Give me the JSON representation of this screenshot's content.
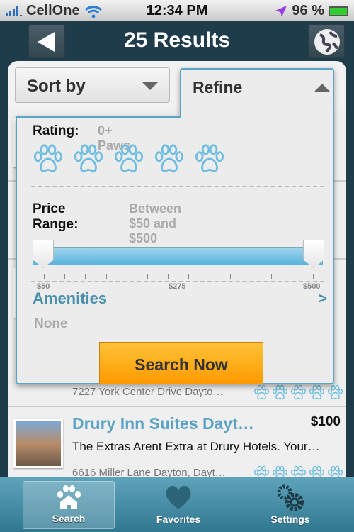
{
  "status_bar": {
    "carrier": "CellOne",
    "time": "12:34 PM",
    "battery": "96 %",
    "icons": [
      "signal-icon",
      "wifi-icon",
      "location-icon",
      "battery-charging-icon"
    ]
  },
  "nav": {
    "title": "25 Results",
    "back_icon": "back-arrow-icon",
    "map_icon": "globe-icon"
  },
  "sort": {
    "label": "Sort by"
  },
  "refine": {
    "label": "Refine",
    "rating_label": "Rating:",
    "rating_value": "0+ Paws",
    "rating_paws_selected": 0,
    "rating_paws_total": 5,
    "price_label": "Price Range:",
    "price_value": "Between $50 and $500",
    "price_min": 50,
    "price_max": 500,
    "tick_labels": [
      "$50",
      "$275",
      "$500"
    ],
    "amenities_label": "Amenities",
    "amenities_chevron": ">",
    "amenities_value": "None",
    "search_button": "Search Now"
  },
  "results": [
    {
      "address": "7227 York Center Drive Dayto…",
      "paws": 5
    },
    {
      "name": "Drury Inn Suites Dayt…",
      "price": "$100",
      "description": "The Extras Arent Extra at Drury Hotels. Your…",
      "address": "6616 Miller Lane Dayton, Dayt…",
      "paws": 5
    }
  ],
  "tabbar": [
    {
      "label": "Search",
      "icon": "paw-house-icon",
      "active": true
    },
    {
      "label": "Favorites",
      "icon": "heart-icon"
    },
    {
      "label": "Settings",
      "icon": "gears-icon"
    }
  ],
  "colors": {
    "accent": "#5ba3c4",
    "nav_bg": "#1f3c4b",
    "button": "#ffa500"
  }
}
